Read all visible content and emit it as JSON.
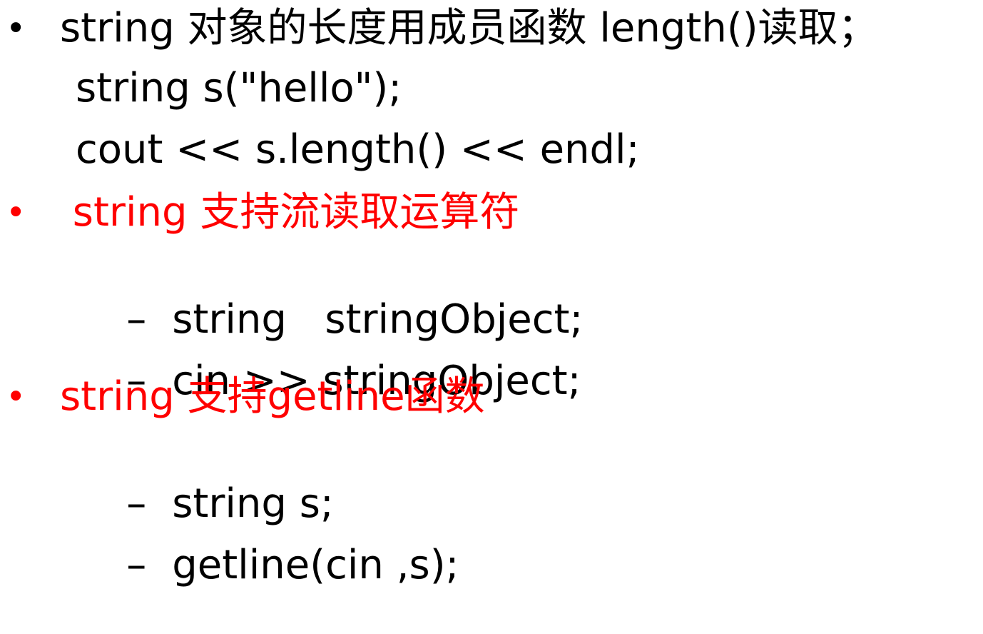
{
  "slide": {
    "items": [
      {
        "bullet": "•",
        "text": "string 对象的长度用成员函数 length()读取；",
        "color": "#000000",
        "sub": [
          "string s(\"hello\");",
          "cout << s.length() << endl;"
        ]
      },
      {
        "bullet": "•",
        "text": " string 支持流读取运算符",
        "color": "#ff0000",
        "dash_items": [
          "string   stringObject;",
          "cin >> stringObject;"
        ]
      },
      {
        "bullet": "•",
        "text": "string 支持getline函数",
        "color": "#ff0000",
        "dash_items": [
          "string s;",
          "getline(cin ,s);"
        ]
      }
    ],
    "dash_symbol": "–"
  }
}
